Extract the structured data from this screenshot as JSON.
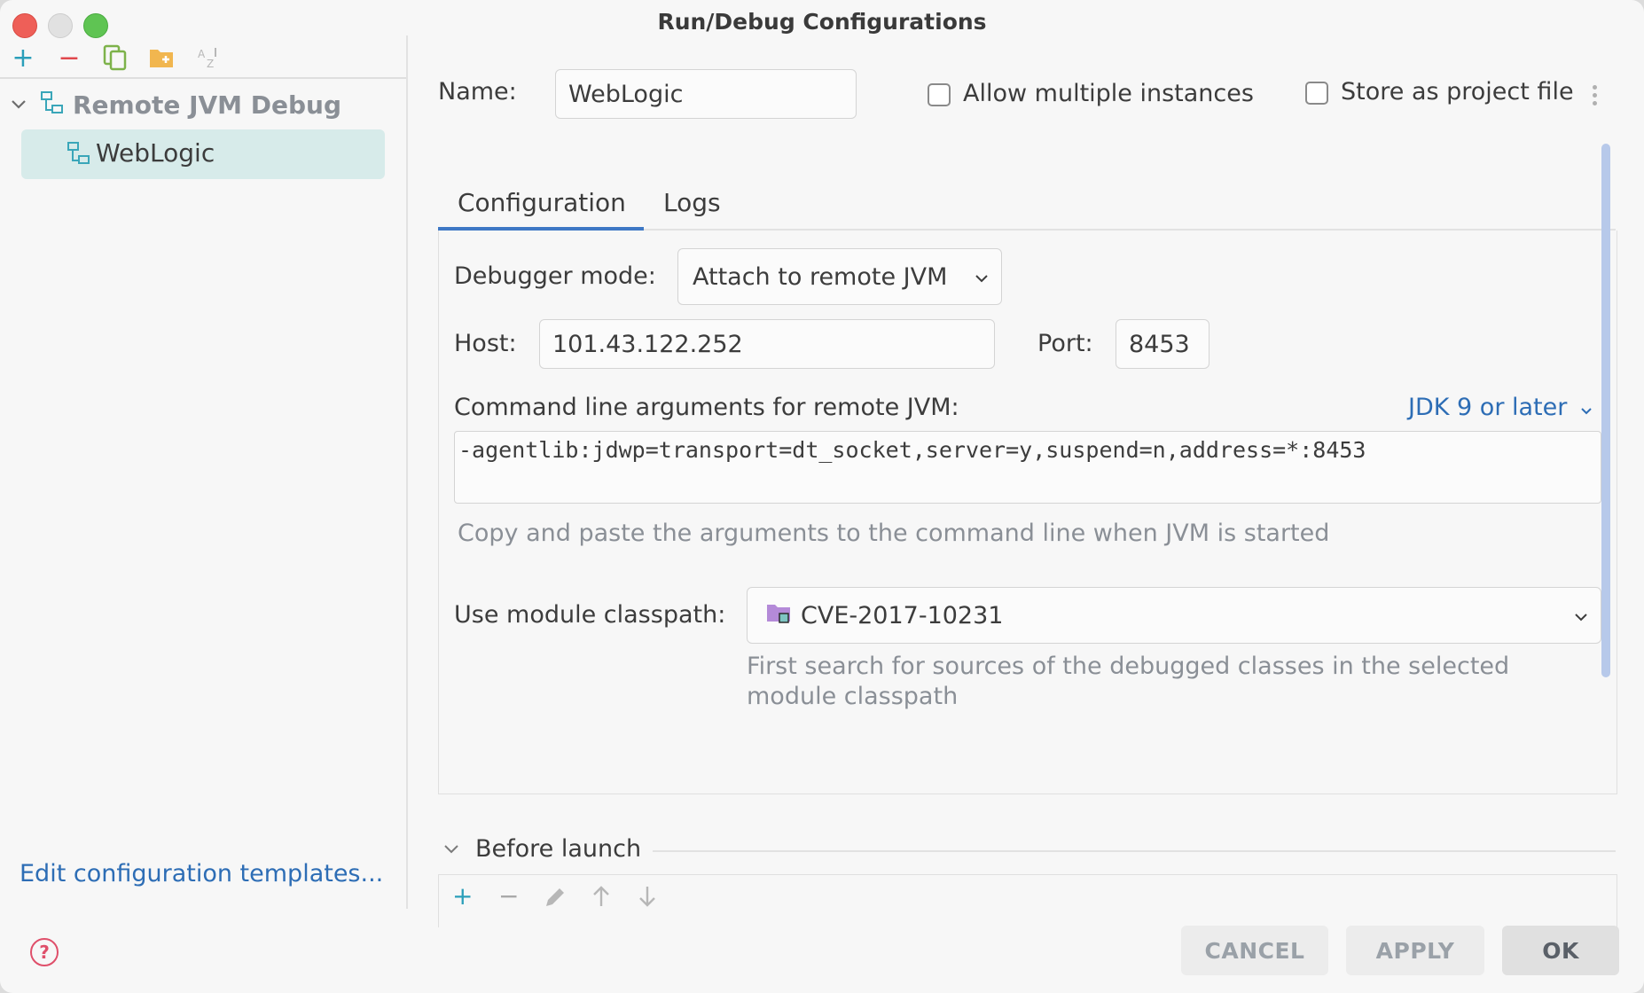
{
  "window": {
    "title": "Run/Debug Configurations"
  },
  "sidebar": {
    "toolbar": [
      {
        "name": "add-icon",
        "glyph": "+",
        "color": "#2b9fba"
      },
      {
        "name": "remove-icon",
        "glyph": "−",
        "color": "#e0484d"
      },
      {
        "name": "copy-icon",
        "glyph": "copy",
        "color": "#7db24a"
      },
      {
        "name": "folder-add-icon",
        "glyph": "folder",
        "color": "#f1b64f"
      },
      {
        "name": "sort-az-icon",
        "glyph": "AZ",
        "color": "#b7b7b7"
      }
    ],
    "tree": {
      "parent_label": "Remote JVM Debug",
      "child_label": "WebLogic"
    },
    "edit_templates_link": "Edit configuration templates..."
  },
  "form": {
    "name_label": "Name:",
    "name_value": "WebLogic",
    "allow_multiple_label": "Allow multiple instances",
    "allow_multiple_checked": false,
    "store_project_label": "Store as project file",
    "store_project_checked": false,
    "tabs": [
      {
        "label": "Configuration",
        "active": true
      },
      {
        "label": "Logs",
        "active": false
      }
    ],
    "debugger_mode_label": "Debugger mode:",
    "debugger_mode_value": "Attach to remote JVM",
    "host_label": "Host:",
    "host_value": "101.43.122.252",
    "port_label": "Port:",
    "port_value": "8453",
    "cmd_label": "Command line arguments for remote JVM:",
    "jdk_link": "JDK 9 or later",
    "cmd_value": "-agentlib:jdwp=transport=dt_socket,server=y,suspend=n,address=*:8453",
    "cmd_hint": "Copy and paste the arguments to the command line when JVM is started",
    "module_label": "Use module classpath:",
    "module_value": "CVE-2017-10231",
    "module_hint_line1": "First search for sources of the debugged classes in the selected",
    "module_hint_line2": "module classpath"
  },
  "before_launch": {
    "title": "Before launch",
    "tools": [
      "add-icon",
      "remove-icon",
      "edit-icon",
      "move-up-icon",
      "move-down-icon"
    ]
  },
  "buttons": {
    "cancel": "CANCEL",
    "apply": "APPLY",
    "ok": "OK"
  },
  "colors": {
    "accent": "#3e78c5",
    "link": "#2d6db5",
    "selection": "#d7ebea"
  }
}
